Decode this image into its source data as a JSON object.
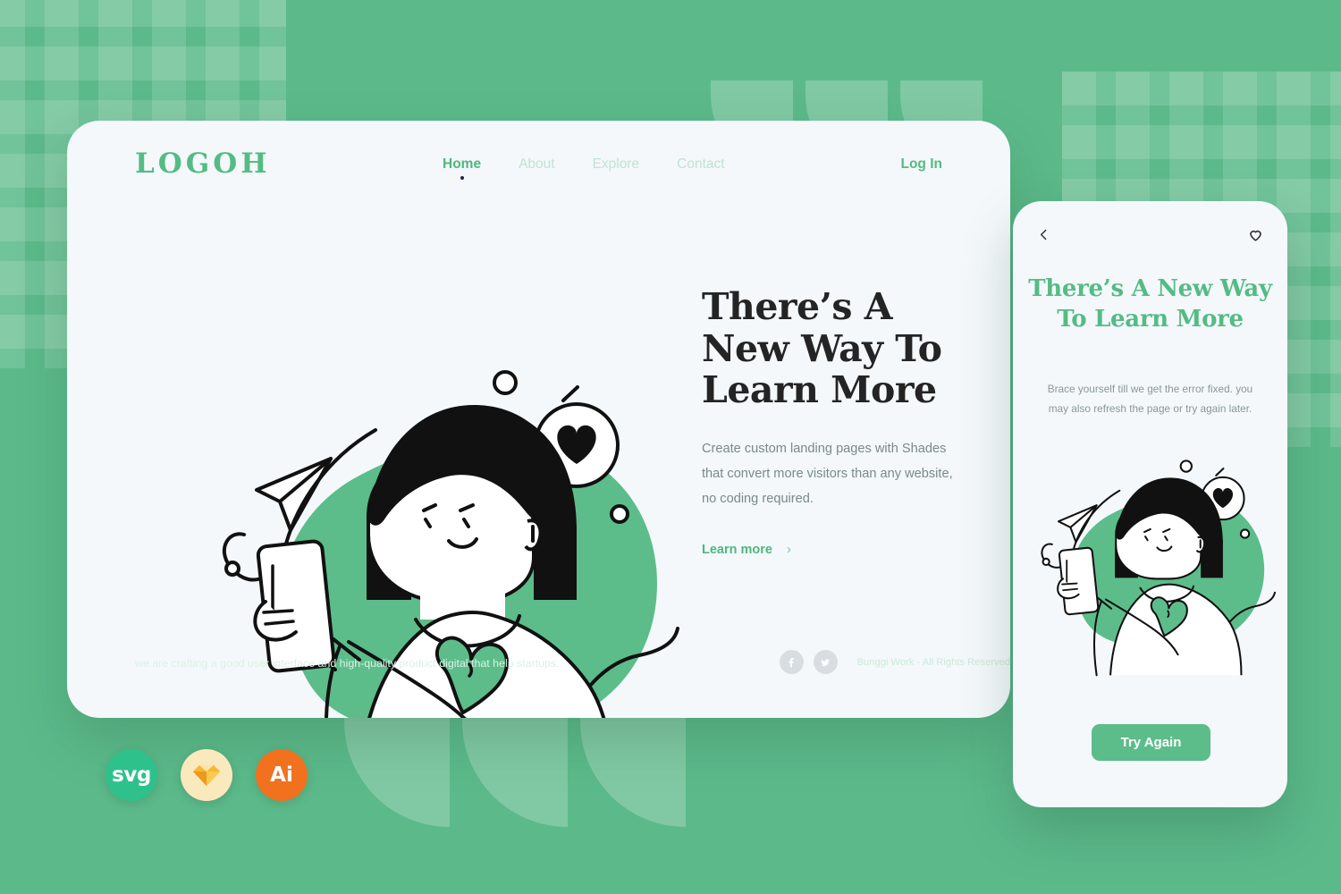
{
  "theme": {
    "bg_green": "#5cba8a",
    "accent_green": "#55bb85",
    "card_bg": "#f4f8fa",
    "heading_dark": "#242424",
    "body_gray": "#7b8a86"
  },
  "desktop": {
    "logo": "LOGOH",
    "nav": [
      {
        "label": "Home",
        "active": true
      },
      {
        "label": "About",
        "active": false
      },
      {
        "label": "Explore",
        "active": false
      },
      {
        "label": "Contact",
        "active": false
      }
    ],
    "login_label": "Log In",
    "hero": {
      "title": "There’s A New Way To Learn More",
      "description": "Create custom landing pages with Shades that convert more visitors than any website, no coding required.",
      "cta_label": "Learn more",
      "cta_chevron": "›"
    },
    "footer": {
      "note": "we are crafting a good user interface and high-quality product digital that help startups.",
      "copyright": "Bunggi Work - All Rights Reserved",
      "social": [
        {
          "name": "facebook-icon"
        },
        {
          "name": "twitter-icon"
        }
      ]
    }
  },
  "mobile": {
    "back_icon": "chevron-left-icon",
    "favorite_icon": "heart-outline-icon",
    "title": "There’s A New Way To Learn More",
    "subtitle": "Brace yourself till we get the error fixed. you may also refresh the page or try again later.",
    "button_label": "Try Again"
  },
  "badges": [
    {
      "label": "svg",
      "name": "svg-format-badge",
      "color": "#2fc18b"
    },
    {
      "label": "",
      "name": "sketch-format-badge",
      "color": "#fae9bd"
    },
    {
      "label": "Ai",
      "name": "illustrator-format-badge",
      "color": "#f2711f"
    }
  ]
}
